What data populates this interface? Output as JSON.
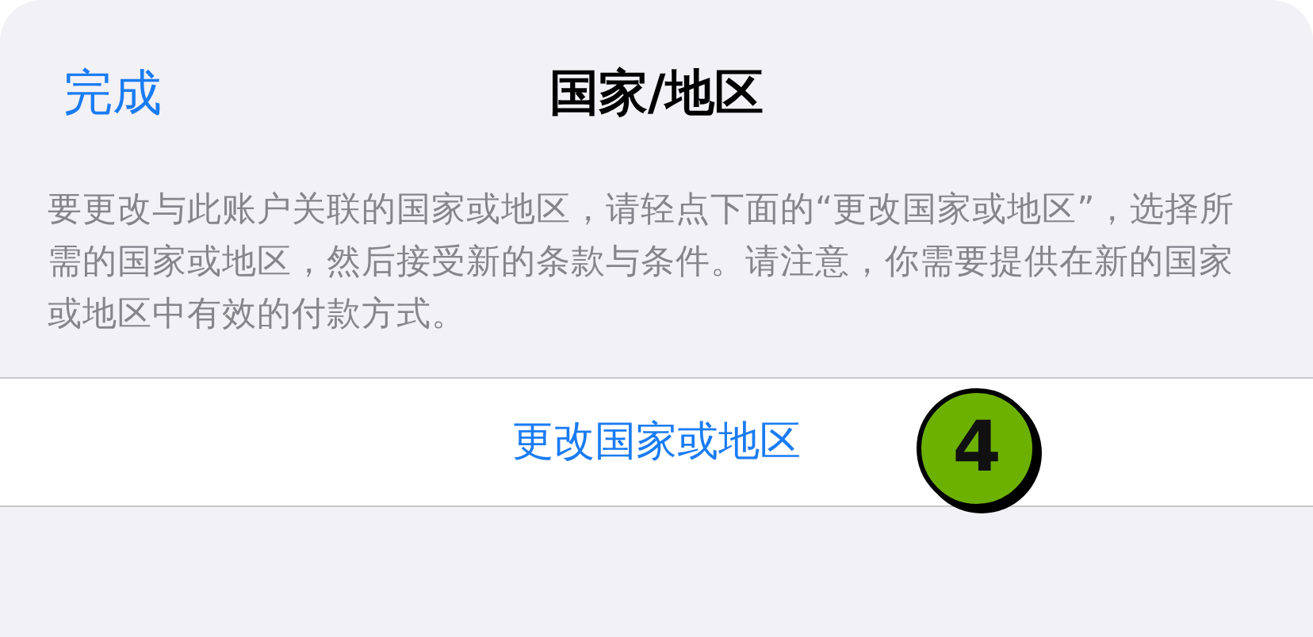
{
  "nav": {
    "done": "完成",
    "title": "国家/地区"
  },
  "description": "要更改与此账户关联的国家或地区，请轻点下面的“更改国家或地区”，选择所需的国家或地区，然后接受新的条款与条件。请注意，你需要提供在新的国家或地区中有效的付款方式。",
  "action": "更改国家或地区",
  "step_badge": "4"
}
